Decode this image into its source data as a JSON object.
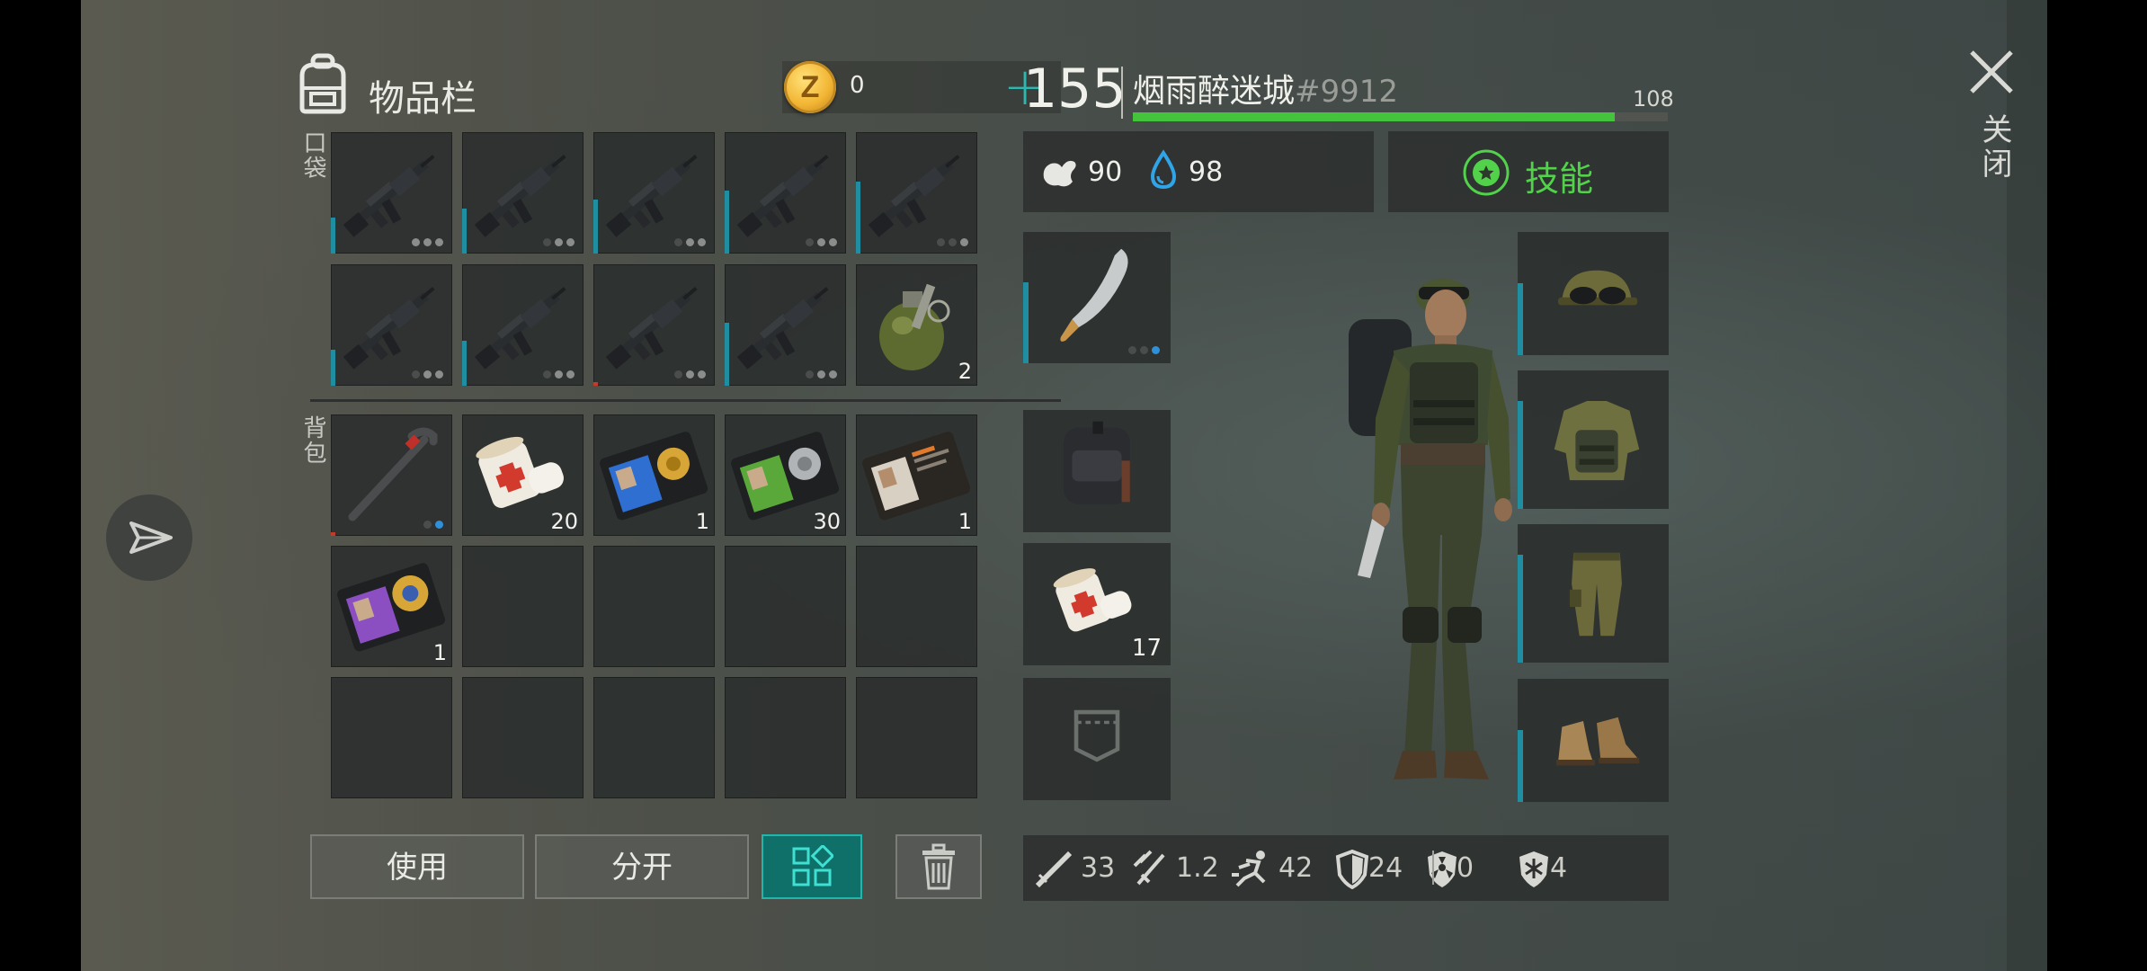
{
  "header": {
    "title": "物品栏",
    "coins": "0",
    "coin_glyph": "Z"
  },
  "labels": {
    "pocket": "口袋",
    "backpack": "背包",
    "close": "关闭"
  },
  "pocket_slots": [
    {
      "item": "assault-rifle",
      "mods": [
        "l",
        "l",
        "l"
      ]
    },
    {
      "item": "assault-rifle",
      "mods": [
        "d",
        "l",
        "l"
      ]
    },
    {
      "item": "assault-rifle",
      "mods": [
        "d",
        "l",
        "l"
      ]
    },
    {
      "item": "assault-rifle",
      "mods": [
        "d",
        "l",
        "l"
      ]
    },
    {
      "item": "assault-rifle",
      "mods": [
        "d",
        "d",
        "l"
      ]
    },
    {
      "item": "assault-rifle",
      "mods": [
        "d",
        "l",
        "l"
      ]
    },
    {
      "item": "assault-rifle",
      "mods": [
        "d",
        "l",
        "l"
      ]
    },
    {
      "item": "assault-rifle",
      "mods": [
        "d",
        "l",
        "l"
      ]
    },
    {
      "item": "assault-rifle",
      "mods": [
        "d",
        "l",
        "l"
      ]
    },
    {
      "item": "frag-grenade",
      "count": "2"
    }
  ],
  "backpack_slots": [
    {
      "item": "crowbar",
      "mods": [
        "d",
        "b"
      ]
    },
    {
      "item": "bandage",
      "count": "20"
    },
    {
      "item": "police-badge-blue",
      "count": "1"
    },
    {
      "item": "police-badge-green",
      "count": "30"
    },
    {
      "item": "patrol-officer-id",
      "count": "1"
    },
    {
      "item": "police-badge-purple",
      "count": "1"
    },
    {},
    {},
    {},
    {},
    {},
    {},
    {},
    {},
    {}
  ],
  "buttons": {
    "use": "使用",
    "split": "分开"
  },
  "player": {
    "level": "155",
    "name": "烟雨醉迷城",
    "tag": "#9912",
    "xp_label": "108",
    "xp_fraction": 0.9,
    "hunger": "90",
    "thirst": "98",
    "skills_label": "技能"
  },
  "equip_left": [
    {
      "item": "machete",
      "mods": [
        "d",
        "d",
        "b"
      ]
    },
    {
      "item": "backpack"
    },
    {
      "item": "bandage",
      "count": "17"
    },
    {
      "item": "empty-pocket"
    }
  ],
  "equip_right": [
    "camo-cap-goggles",
    "camo-armor-vest",
    "camo-pants",
    "leather-boots"
  ],
  "bottom_stats": {
    "damage": "33",
    "attack_speed": "1.2",
    "speed": "42",
    "armor": "24",
    "radiation": "0",
    "cold": "4"
  },
  "colors": {
    "accent_teal": "#1fb7ad",
    "xp_green": "#44c43c",
    "skill_green": "#52d24a",
    "durability": "#1e8ea0"
  }
}
